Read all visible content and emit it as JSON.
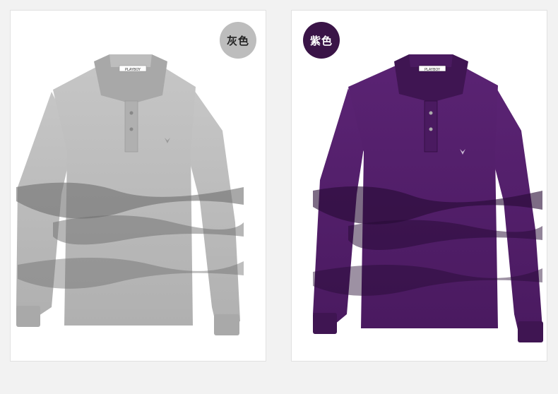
{
  "products": [
    {
      "color_label": "灰色",
      "shirt_color": "#b8b8b8",
      "shade_color": "#6e6e6e",
      "badge_color": "#bdbdbd"
    },
    {
      "color_label": "紫色",
      "shirt_color": "#4f1c66",
      "shade_color": "#260a33",
      "badge_color": "#3a1447"
    }
  ],
  "brand_tag": "PLAYBOY"
}
